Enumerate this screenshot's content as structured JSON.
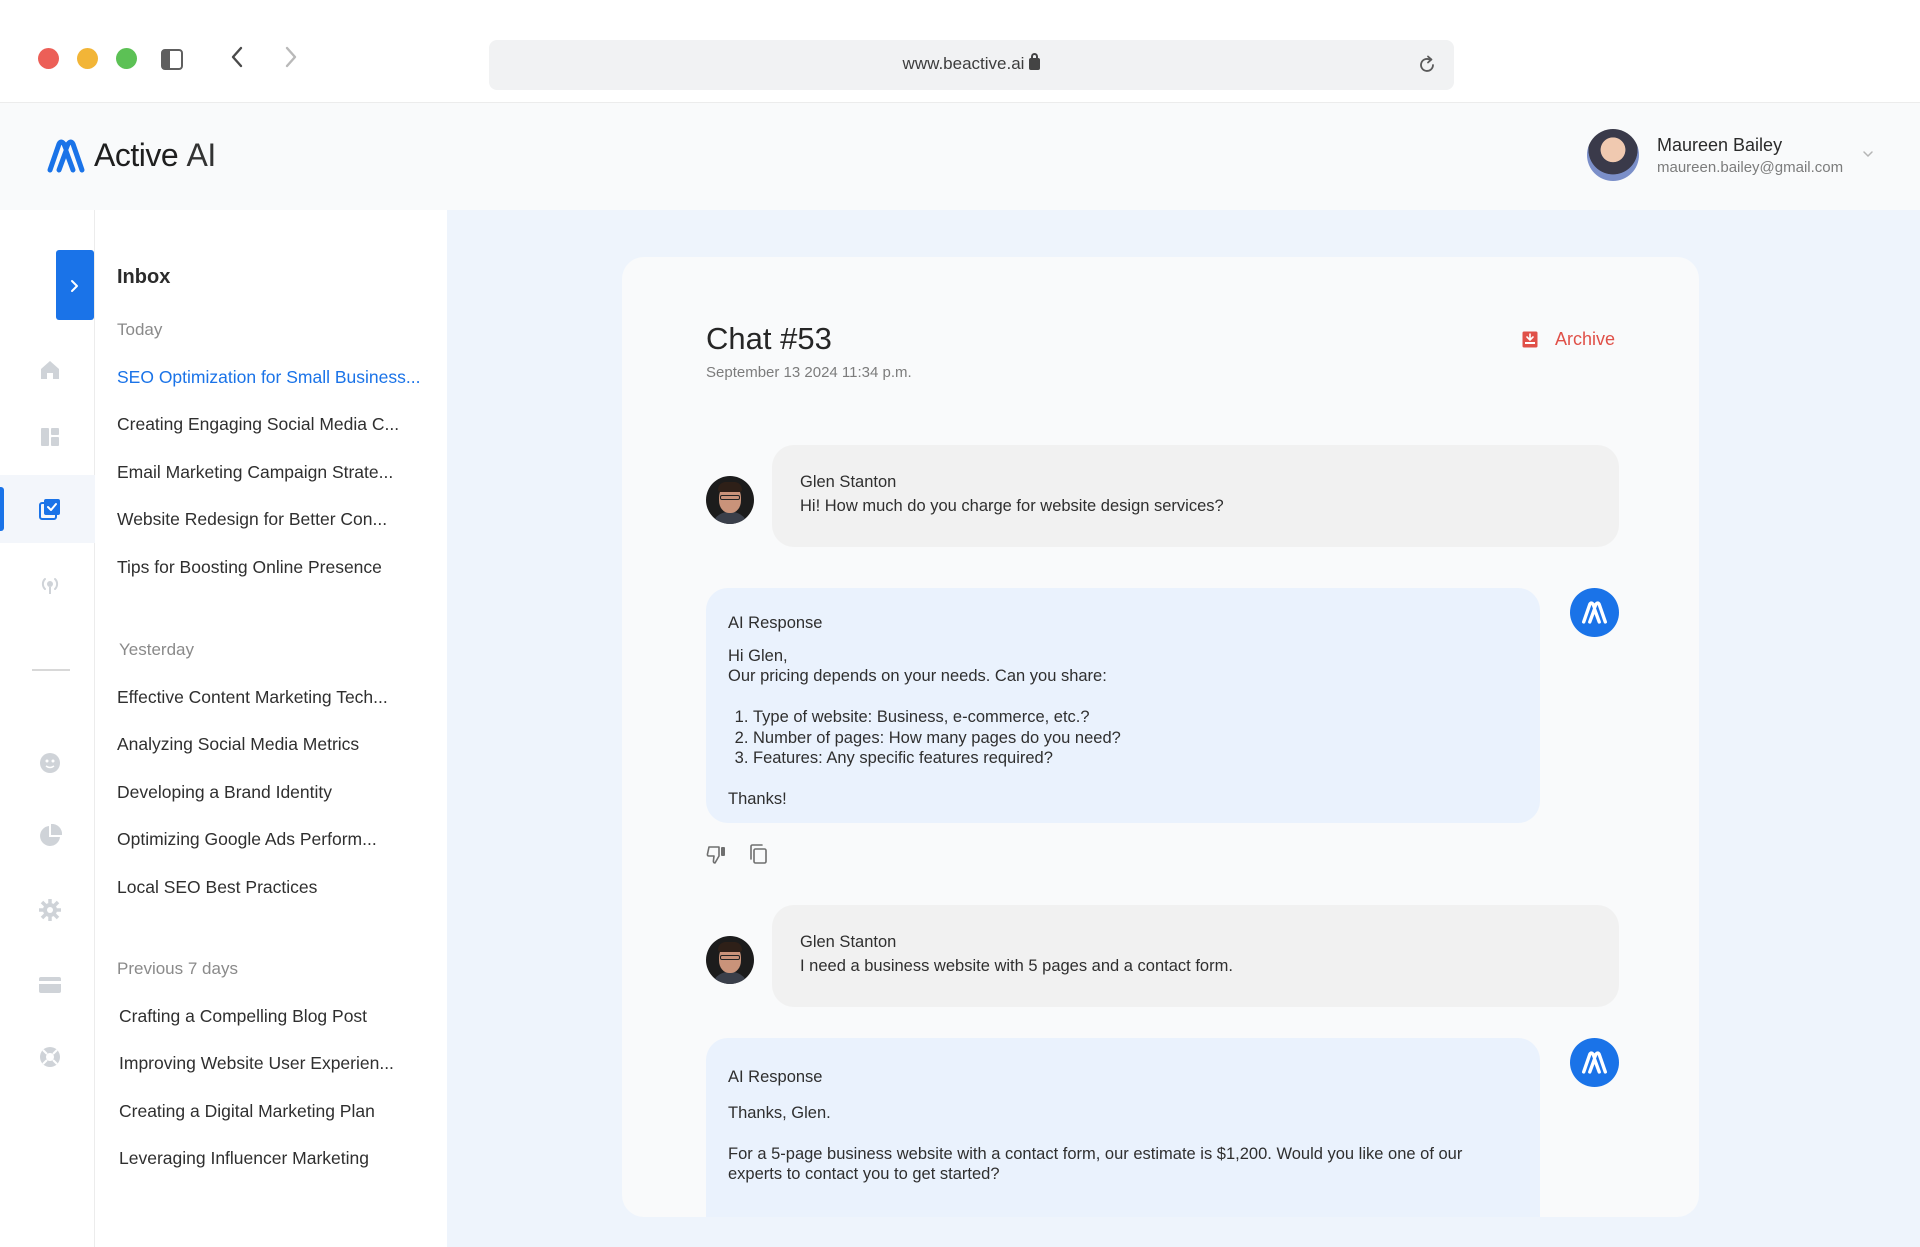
{
  "browser": {
    "url": "www.beactive.ai"
  },
  "app": {
    "logo_name": "Active",
    "logo_suffix": "AI",
    "brand_color": "#1a73e8"
  },
  "user": {
    "name": "Maureen Bailey",
    "email": "maureen.bailey@gmail.com"
  },
  "rail": {
    "icons": [
      "home-icon",
      "dashboard-icon",
      "inbox-check-icon",
      "broadcast-icon",
      "face-icon",
      "pie-chart-icon",
      "gear-icon",
      "credit-card-icon",
      "lifebuoy-icon"
    ],
    "active": "inbox-check-icon"
  },
  "inbox": {
    "title": "Inbox",
    "groups": [
      {
        "label": "Today",
        "items": [
          "SEO Optimization for Small Business...",
          "Creating Engaging Social Media C...",
          "Email Marketing Campaign Strate...",
          "Website Redesign for Better Con...",
          "Tips for Boosting Online Presence"
        ]
      },
      {
        "label": "Yesterday",
        "items": [
          "Effective Content Marketing Tech...",
          "Analyzing Social Media Metrics",
          "Developing a Brand Identity",
          "Optimizing Google Ads Perform...",
          "Local SEO Best Practices"
        ]
      },
      {
        "label": "Previous 7 days",
        "items": [
          "Crafting a Compelling Blog Post",
          "Improving Website User Experien...",
          "Creating a Digital Marketing Plan",
          "Leveraging Influencer Marketing"
        ]
      }
    ]
  },
  "chat": {
    "title": "Chat #53",
    "date": "September 13 2024 11:34 p.m.",
    "archive_label": "Archive",
    "messages": [
      {
        "sender": "Glen Stanton",
        "text": "Hi! How much do you charge for website design services?"
      },
      {
        "label": "AI Response",
        "greeting": "Hi Glen,",
        "intro": "Our pricing depends on your needs. Can you share:",
        "list": [
          "Type of website: Business, e-commerce, etc.?",
          "Number of pages: How many pages do you need?",
          "Features: Any specific features required?"
        ],
        "closing": "Thanks!"
      },
      {
        "sender": "Glen Stanton",
        "text": "I need a business website with 5 pages and a contact form."
      },
      {
        "label": "AI Response",
        "line1": "Thanks, Glen.",
        "line2": "For a 5-page business website with a contact form, our estimate is $1,200. Would you like one of our",
        "line3": "experts to contact you to get started?"
      }
    ]
  }
}
